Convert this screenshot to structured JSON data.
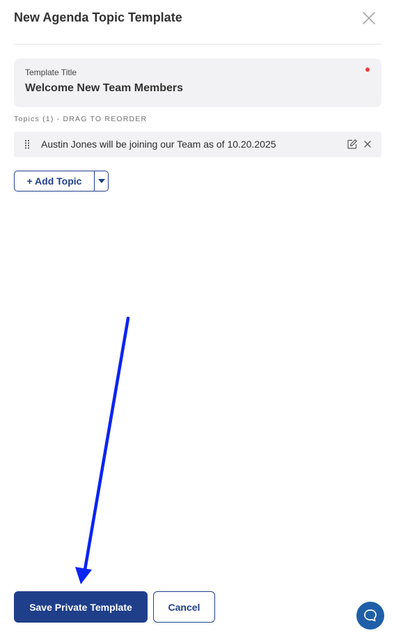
{
  "header": {
    "title": "New Agenda Topic Template",
    "close_icon": "close-icon"
  },
  "template_title_field": {
    "label": "Template Title",
    "value": "Welcome New Team Members",
    "required_indicator_color": "#ef3b3b"
  },
  "topics": {
    "header": "Topics (1) - DRAG TO REORDER",
    "items": [
      {
        "text": "Austin Jones will be joining our Team as of 10.20.2025",
        "icons": [
          "drag-handle-icon",
          "edit-icon",
          "close-icon"
        ]
      }
    ]
  },
  "add_topic": {
    "label": "+ Add Topic",
    "dropdown_icon": "caret-down-icon"
  },
  "footer": {
    "save_label": "Save Private Template",
    "cancel_label": "Cancel",
    "help_icon": "chat-bubble-icon"
  },
  "colors": {
    "primary": "#1f3f8a",
    "annotation_arrow": "#0b24f2",
    "help_button": "#1e5fa8",
    "field_background": "#f2f2f4"
  }
}
